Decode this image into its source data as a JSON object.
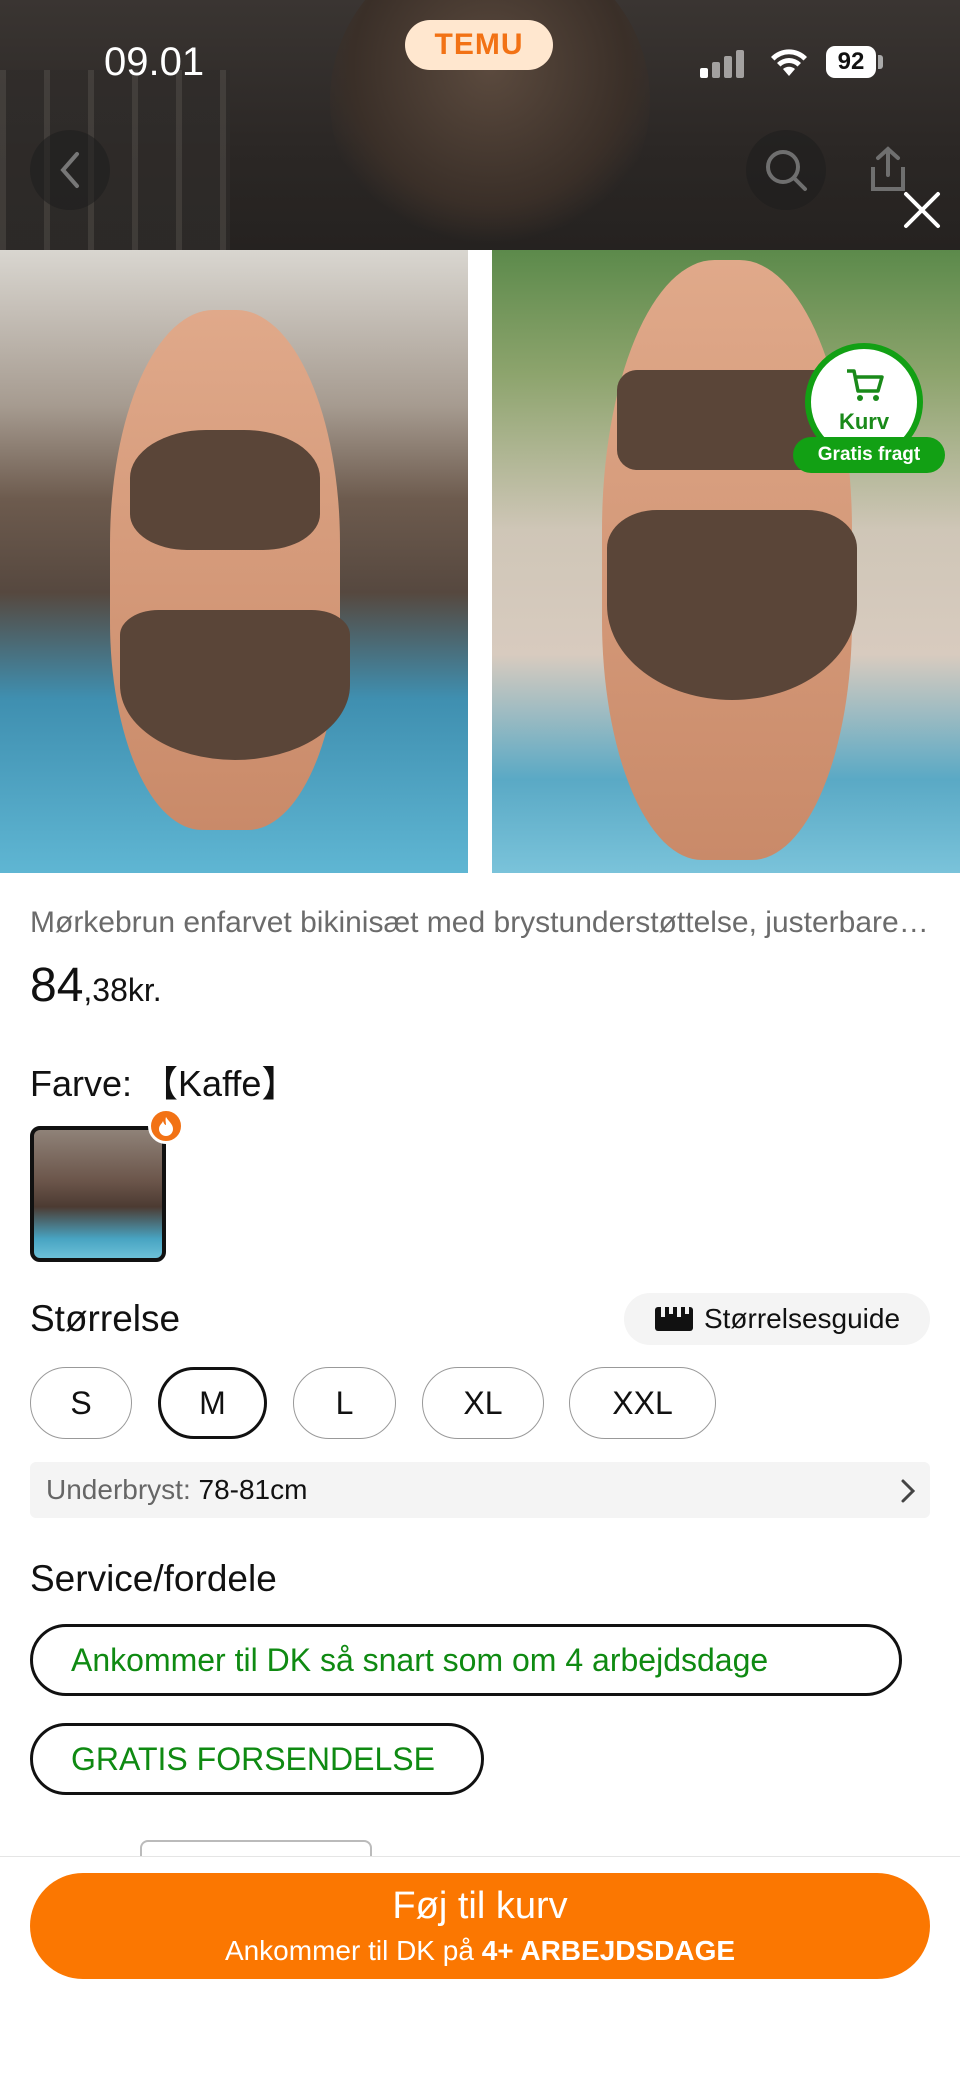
{
  "status_bar": {
    "time": "09.01",
    "battery": "92"
  },
  "brand": {
    "logo_text": "TEMU"
  },
  "cart_badge": {
    "label": "Kurv",
    "gratis": "Gratis fragt"
  },
  "product": {
    "title": "Mørkebrun enfarvet bikinisæt med brystunderstøttelse, justerbare stropper",
    "price_main": "84",
    "price_fraction": ",38kr."
  },
  "color": {
    "label": "Farve:",
    "value": "【Kaffe】"
  },
  "size": {
    "label": "Størrelse",
    "guide": "Størrelsesguide",
    "options": [
      "S",
      "M",
      "L",
      "XL",
      "XXL"
    ],
    "selected": "M",
    "underbust_label": "Underbryst:",
    "underbust_value": "78-81cm"
  },
  "service": {
    "label": "Service/fordele",
    "items": [
      "Ankommer til DK så snart som om 4 arbejdsdage",
      "GRATIS FORSENDELSE"
    ]
  },
  "cta": {
    "label": "Føj til kurv",
    "sub_prefix": "Ankommer til DK på",
    "sub_bold": "4+ ARBEJDSDAGE"
  },
  "icons": [
    "back-icon",
    "search-icon",
    "share-icon",
    "close-icon",
    "cart-icon",
    "fire-icon",
    "ruler-icon",
    "chevron-right-icon"
  ],
  "colors": {
    "accent": "#fb7701",
    "green": "#12a014",
    "service_text": "#0f8a12"
  }
}
